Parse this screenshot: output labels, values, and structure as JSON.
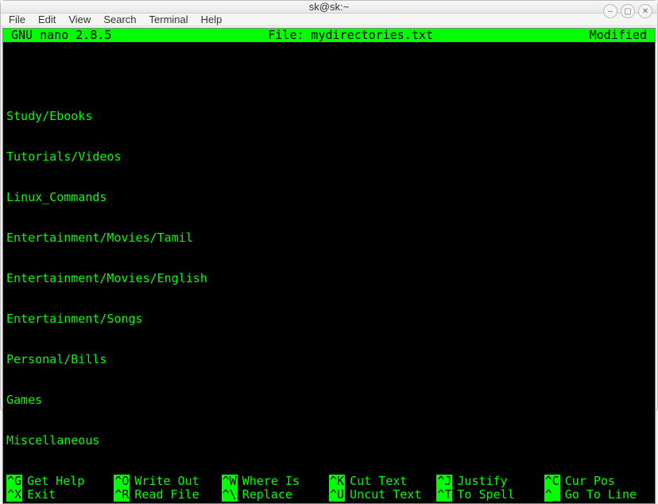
{
  "window": {
    "title": "sk@sk:~",
    "buttons": {
      "min": "–",
      "max": "▢",
      "close": "✕"
    }
  },
  "menubar": [
    "File",
    "Edit",
    "View",
    "Search",
    "Terminal",
    "Help"
  ],
  "nano": {
    "header": {
      "version": "  GNU nano 2.8.5",
      "file": "File: mydirectories.txt",
      "status": "Modified"
    },
    "content": [
      "Study/Ebooks",
      "Tutorials/Videos",
      "Linux_Commands",
      "Entertainment/Movies/Tamil",
      "Entertainment/Movies/English",
      "Entertainment/Songs",
      "Personal/Bills",
      "Games",
      "Miscellaneous"
    ],
    "footer": [
      [
        {
          "key": "^G",
          "label": "Get Help"
        },
        {
          "key": "^O",
          "label": "Write Out"
        },
        {
          "key": "^W",
          "label": "Where Is"
        },
        {
          "key": "^K",
          "label": "Cut Text"
        },
        {
          "key": "^J",
          "label": "Justify"
        },
        {
          "key": "^C",
          "label": "Cur Pos"
        }
      ],
      [
        {
          "key": "^X",
          "label": "Exit"
        },
        {
          "key": "^R",
          "label": "Read File"
        },
        {
          "key": "^\\",
          "label": "Replace"
        },
        {
          "key": "^U",
          "label": "Uncut Text"
        },
        {
          "key": "^T",
          "label": "To Spell"
        },
        {
          "key": "^_",
          "label": "Go To Line"
        }
      ]
    ]
  }
}
